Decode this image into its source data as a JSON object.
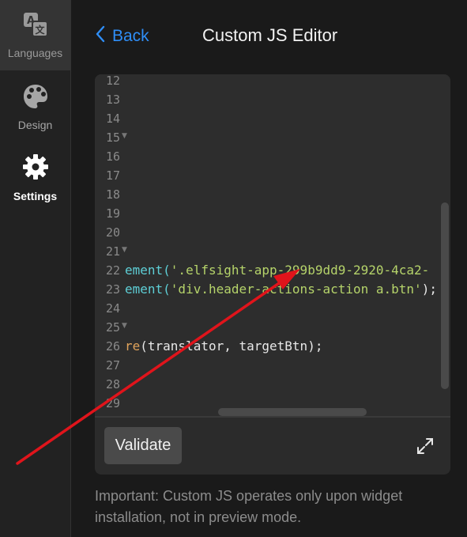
{
  "sidebar": {
    "items": [
      {
        "label": "Languages",
        "icon": "translate-icon"
      },
      {
        "label": "Design",
        "icon": "palette-icon"
      },
      {
        "label": "Settings",
        "icon": "gear-icon"
      }
    ]
  },
  "header": {
    "back_label": "Back",
    "title": "Custom JS Editor"
  },
  "editor": {
    "line_numbers": [
      "12",
      "13",
      "14",
      "15",
      "16",
      "17",
      "18",
      "19",
      "20",
      "21",
      "22",
      "23",
      "24",
      "25",
      "26",
      "27",
      "28",
      "29"
    ],
    "folded_lines": [
      "15",
      "21",
      "25"
    ],
    "code": {
      "line22_a": "ement(",
      "line22_b": "'.elfsight-app-299b9dd9-2920-4ca2-",
      "line23_a": "ement(",
      "line23_b": "'div.header-actions-action a.btn'",
      "line23_c": ");",
      "line26_a": "re",
      "line26_b": "(translator, targetBtn);"
    },
    "validate_label": "Validate"
  },
  "note": "Important: Custom JS operates only upon widget installation, not in preview mode.",
  "colors": {
    "accent": "#2f8ef7",
    "annotation_arrow": "#e0141b"
  }
}
